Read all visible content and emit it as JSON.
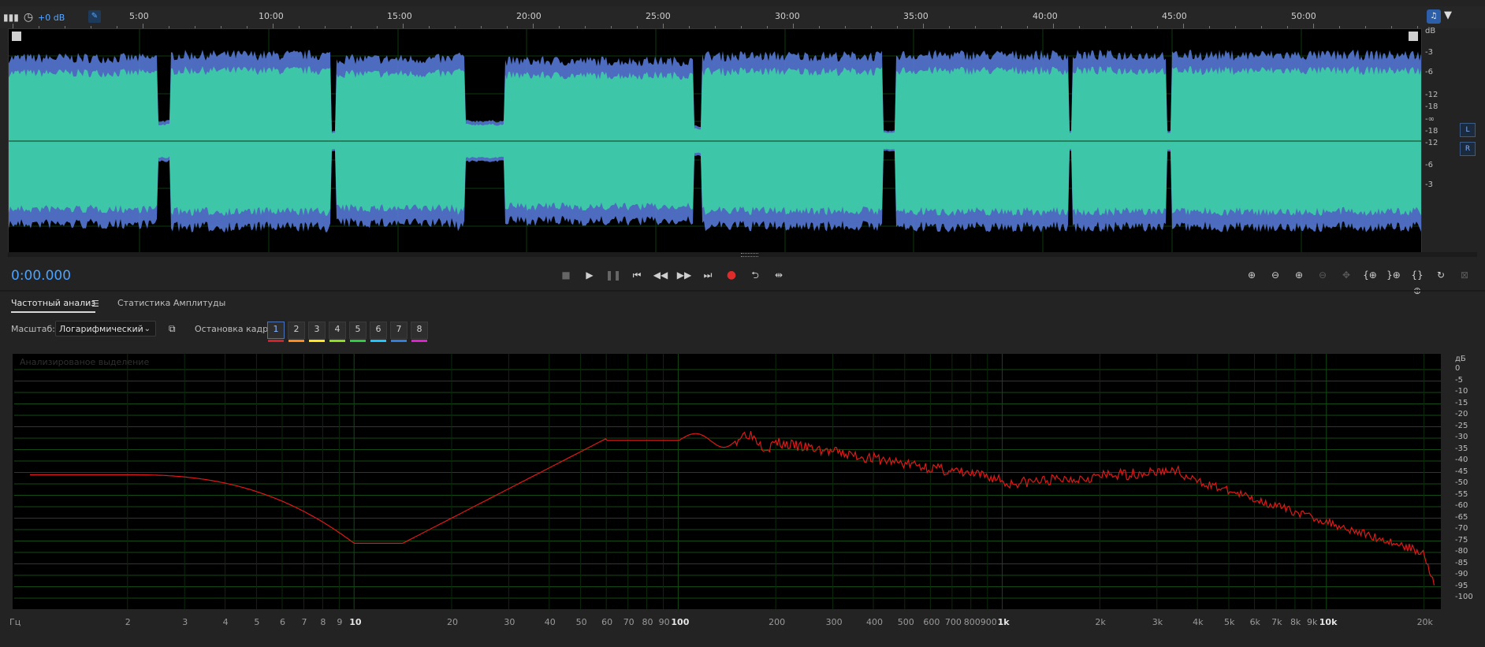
{
  "toolbar": {
    "volume_label": "+0 dB"
  },
  "ruler": {
    "ticks": [
      "5:00",
      "10:00",
      "15:00",
      "20:00",
      "25:00",
      "30:00",
      "35:00",
      "40:00",
      "45:00",
      "50:00"
    ]
  },
  "waveform": {
    "db_labels": [
      "dB",
      "-3",
      "-6",
      "-12",
      "-18",
      "-∞",
      "-18",
      "-12",
      "-6",
      "-3"
    ],
    "channels": [
      "L",
      "R"
    ],
    "colors": {
      "wave": "#3ec6a8",
      "peak": "#5b7ee0",
      "background": "#000000"
    }
  },
  "transport": {
    "time": "0:00.000",
    "buttons": [
      "stop-icon",
      "play-icon",
      "pause-icon",
      "skip-start-icon",
      "rewind-icon",
      "fast-forward-icon",
      "skip-end-icon",
      "record-icon",
      "loop-icon",
      "skip-silence-icon"
    ]
  },
  "zoom": {
    "buttons": [
      "zoom-in-amplitude-icon",
      "zoom-out-amplitude-icon",
      "zoom-in-time-icon",
      "zoom-out-time-icon",
      "zoom-fit-icon",
      "zoom-in-start-icon",
      "zoom-in-end-icon",
      "zoom-selection-icon",
      "zoom-reset-icon",
      "zoom-full-icon"
    ]
  },
  "panel": {
    "tab_frequency": "Частотный анализ",
    "tab_amplitude": "Статистика Амплитуды",
    "scale_label": "Масштаб:",
    "scale_value": "Логарифмический",
    "hold_label": "Остановка кадра:",
    "holds": [
      "1",
      "2",
      "3",
      "4",
      "5",
      "6",
      "7",
      "8"
    ],
    "hold_colors": [
      "#d4202a",
      "#ff8a1a",
      "#ffe51a",
      "#8be01a",
      "#2ecc40",
      "#1ac8ff",
      "#2f7fe0",
      "#e020d0"
    ],
    "selected_hold": "1",
    "spectrum_caption": "Анализированое выделение"
  },
  "spectrum": {
    "freq_labels": [
      "Гц",
      "2",
      "3",
      "4",
      "5",
      "6",
      "7",
      "8",
      "9",
      "10",
      "20",
      "30",
      "40",
      "50",
      "60",
      "70",
      "80",
      "90",
      "100",
      "200",
      "300",
      "400",
      "500",
      "600",
      "700",
      "800",
      "900",
      "1k",
      "2k",
      "3k",
      "4k",
      "5k",
      "6k",
      "7k",
      "8k",
      "9k",
      "10k",
      "20k"
    ],
    "db_labels": [
      "дБ",
      "0",
      "-5",
      "-10",
      "-15",
      "-20",
      "-25",
      "-30",
      "-35",
      "-40",
      "-45",
      "-50",
      "-55",
      "-60",
      "-65",
      "-70",
      "-75",
      "-80",
      "-85",
      "-90",
      "-95",
      "-100"
    ],
    "colors": {
      "left": "#3ec6a8",
      "right": "#e01818",
      "grid": "#144a14"
    }
  }
}
